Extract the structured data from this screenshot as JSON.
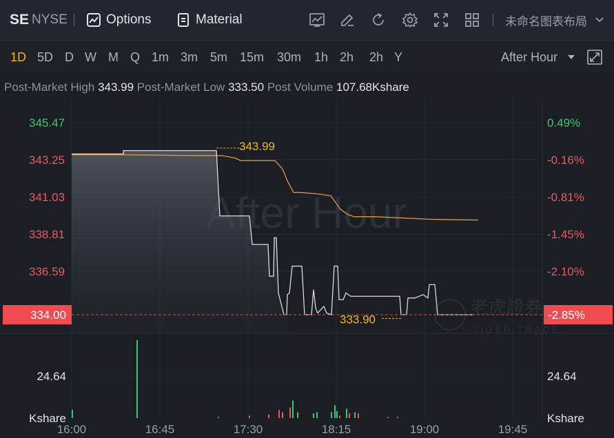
{
  "header": {
    "symbol": "SE",
    "exchange": "NYSE",
    "options_label": "Options",
    "material_label": "Material",
    "layout_label": "未命名图表布局",
    "icons": [
      "chart-style-icon",
      "draw-icon",
      "refresh-icon",
      "settings-icon",
      "fullscreen-arrows-icon",
      "grid-layout-icon"
    ]
  },
  "periods": [
    "1D",
    "5D",
    "D",
    "W",
    "M",
    "Q",
    "1m",
    "3m",
    "5m",
    "15m",
    "30m",
    "1h",
    "2h",
    "2h",
    "Y"
  ],
  "active_period": "1D",
  "session_select": "After Hour",
  "stats": {
    "high_label": "Post-Market High",
    "high_value": "343.99",
    "low_label": "Post-Market Low",
    "low_value": "333.50",
    "volume_label": "Post Volume",
    "volume_value": "107.68Kshare"
  },
  "watermark": "After Hour",
  "brand_watermark": {
    "cn": "老虎證券",
    "en": "TIGER TRADE"
  },
  "colors": {
    "up": "#3fc96b",
    "down": "#f0585e",
    "price_line": "#d8dbe0",
    "avg_line": "#e8963a",
    "label_yellow": "#f0b90b",
    "current_tag": "#f04b4f",
    "accent": "#f0b90b"
  },
  "chart_data": {
    "type": "line",
    "series": [],
    "y_left_ticks": [
      "345.47",
      "343.25",
      "341.03",
      "338.81",
      "336.59"
    ],
    "y_right_ticks": [
      "0.49%",
      "-0.16%",
      "-0.81%",
      "-1.45%",
      "-2.10%"
    ],
    "ylim": [
      333.5,
      346.5
    ],
    "x_ticks": [
      "16:00",
      "16:45",
      "17:30",
      "18:15",
      "19:00",
      "19:45"
    ],
    "current_price": "334.00",
    "current_change": "-2.85%",
    "high_marker": "343.99",
    "low_marker": "333.90",
    "volume_tick_left": "24.64",
    "volume_tick_right": "24.64",
    "volume_unit": "Kshare",
    "price_points": [
      [
        0,
        343.6
      ],
      [
        75,
        343.6
      ],
      [
        75,
        343.8
      ],
      [
        210,
        343.8
      ],
      [
        215,
        339.9
      ],
      [
        258,
        339.9
      ],
      [
        262,
        338.2
      ],
      [
        285,
        338.2
      ],
      [
        287,
        336.3
      ],
      [
        293,
        336.3
      ],
      [
        294,
        338.6
      ],
      [
        297,
        338.6
      ],
      [
        300,
        335.3
      ],
      [
        308,
        334.0
      ],
      [
        312,
        334.0
      ],
      [
        313,
        335.2
      ],
      [
        316,
        335.3
      ],
      [
        320,
        336.9
      ],
      [
        334,
        336.9
      ],
      [
        338,
        334.0
      ],
      [
        348,
        334.0
      ],
      [
        351,
        335.5
      ],
      [
        354,
        334.4
      ],
      [
        357,
        334.1
      ],
      [
        366,
        334.5
      ],
      [
        370,
        334.1
      ],
      [
        377,
        334.0
      ],
      [
        381,
        336.9
      ],
      [
        386,
        336.9
      ],
      [
        388,
        334.9
      ],
      [
        394,
        334.9
      ],
      [
        398,
        335.3
      ],
      [
        405,
        335.1
      ],
      [
        476,
        335.1
      ],
      [
        478,
        334.0
      ],
      [
        486,
        334.0
      ],
      [
        488,
        335.0
      ],
      [
        496,
        335.0
      ],
      [
        498,
        335.0
      ],
      [
        510,
        335.2
      ],
      [
        517,
        335.0
      ],
      [
        519,
        335.8
      ],
      [
        527,
        335.8
      ],
      [
        531,
        334.0
      ],
      [
        585,
        334.0
      ]
    ],
    "avg_points": [
      [
        0,
        343.55
      ],
      [
        75,
        343.55
      ],
      [
        180,
        343.5
      ],
      [
        218,
        343.5
      ],
      [
        238,
        343.35
      ],
      [
        245,
        343.2
      ],
      [
        295,
        343.2
      ],
      [
        306,
        342.7
      ],
      [
        313,
        342.0
      ],
      [
        318,
        341.6
      ],
      [
        322,
        341.3
      ],
      [
        332,
        341.3
      ],
      [
        360,
        341.2
      ],
      [
        376,
        341.1
      ],
      [
        383,
        340.7
      ],
      [
        390,
        340.3
      ],
      [
        400,
        340.0
      ],
      [
        410,
        339.85
      ],
      [
        440,
        339.85
      ],
      [
        520,
        339.7
      ],
      [
        590,
        339.65
      ]
    ],
    "volume_bars": [
      [
        0,
        7,
        "up"
      ],
      [
        94,
        67,
        "up"
      ],
      [
        212,
        1,
        "up"
      ],
      [
        257,
        2,
        "down"
      ],
      [
        285,
        3,
        "down"
      ],
      [
        300,
        7,
        "down"
      ],
      [
        305,
        5,
        "down"
      ],
      [
        316,
        9,
        "down"
      ],
      [
        320,
        15,
        "up"
      ],
      [
        327,
        5,
        "up"
      ],
      [
        350,
        4,
        "up"
      ],
      [
        355,
        5,
        "up"
      ],
      [
        376,
        5,
        "up"
      ],
      [
        381,
        11,
        "up"
      ],
      [
        384,
        6,
        "up"
      ],
      [
        388,
        2,
        "down"
      ],
      [
        398,
        8,
        "up"
      ],
      [
        402,
        4,
        "down"
      ],
      [
        410,
        5,
        "up"
      ],
      [
        415,
        4,
        "down"
      ],
      [
        458,
        1,
        "down"
      ],
      [
        472,
        1,
        "down"
      ]
    ]
  }
}
